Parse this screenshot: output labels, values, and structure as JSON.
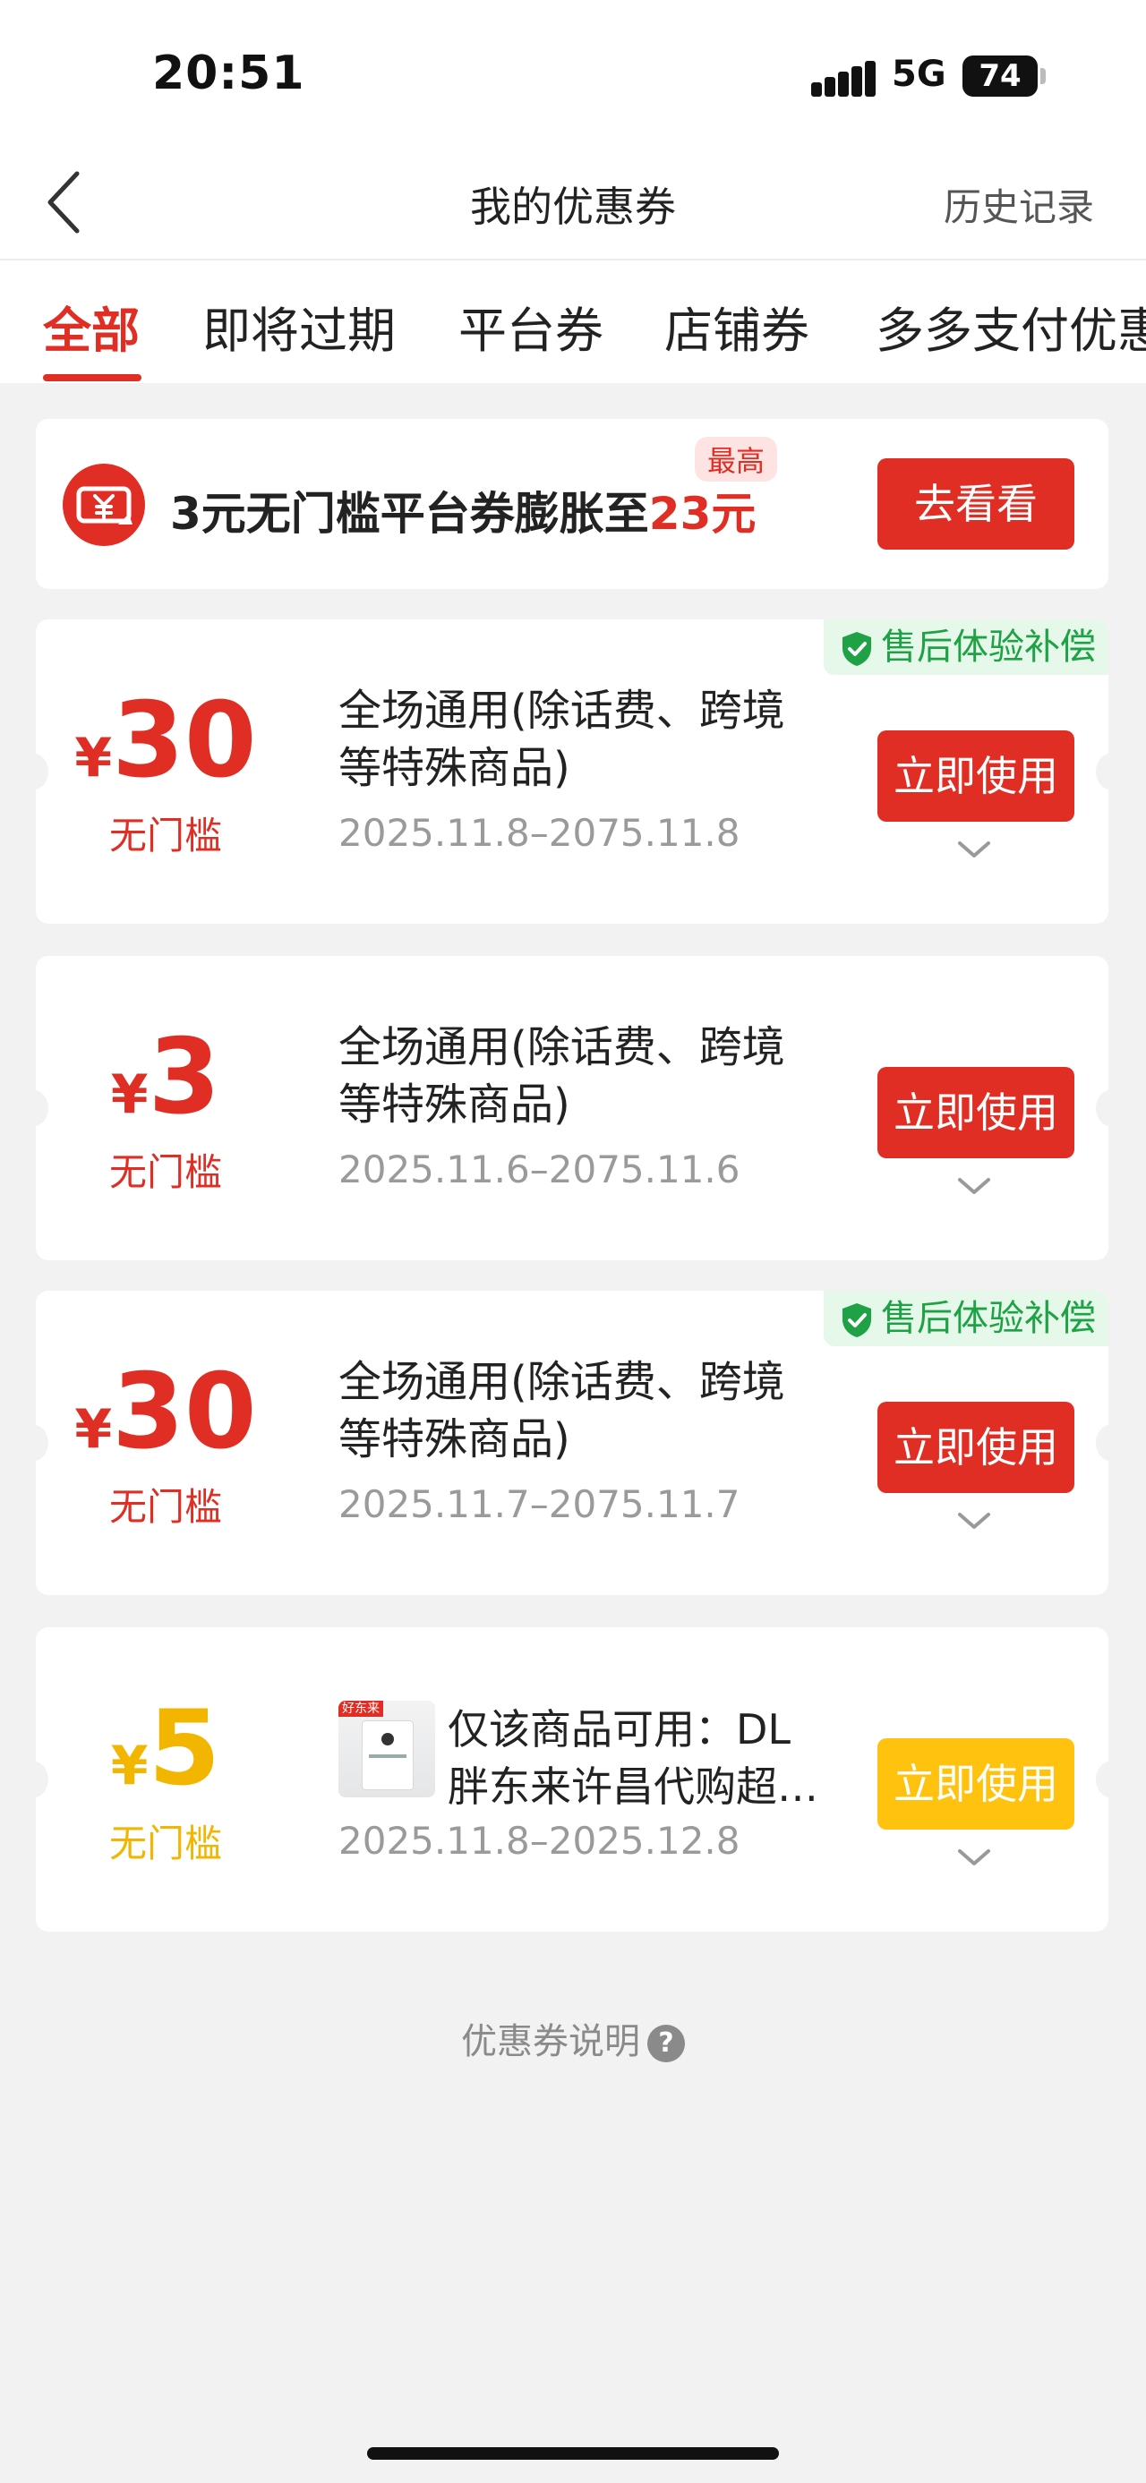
{
  "status_bar": {
    "time": "20:51",
    "network": "5G",
    "battery": "74"
  },
  "nav": {
    "title": "我的优惠券",
    "history": "历史记录"
  },
  "tabs": [
    {
      "label": "全部",
      "active": true
    },
    {
      "label": "即将过期",
      "active": false
    },
    {
      "label": "平台券",
      "active": false
    },
    {
      "label": "店铺券",
      "active": false
    },
    {
      "label": "多多支付优惠",
      "active": false
    }
  ],
  "promo": {
    "text_prefix": "3元无门槛平台券膨胀至",
    "highlight": "23元",
    "tag": "最高",
    "button": "去看看"
  },
  "coupons": [
    {
      "currency": "¥",
      "amount": "30",
      "threshold": "无门槛",
      "description": "全场通用(除话费、跨境等特殊商品)",
      "date": "2025.11.8–2075.11.8",
      "button": "立即使用",
      "badge": "售后体验补偿"
    },
    {
      "currency": "¥",
      "amount": "3",
      "threshold": "无门槛",
      "description": "全场通用(除话费、跨境等特殊商品)",
      "date": "2025.11.6–2075.11.6",
      "button": "立即使用"
    },
    {
      "currency": "¥",
      "amount": "30",
      "threshold": "无门槛",
      "description": "全场通用(除话费、跨境等特殊商品)",
      "date": "2025.11.7–2075.11.7",
      "button": "立即使用",
      "badge": "售后体验补偿"
    },
    {
      "currency": "¥",
      "amount": "5",
      "threshold": "无门槛",
      "description": "仅该商品可用：DL 胖东来许昌代购超…",
      "date": "2025.11.8–2025.12.8",
      "button": "立即使用",
      "thumb_tag": "好东来"
    }
  ],
  "footer": {
    "explain": "优惠券说明",
    "help_glyph": "?"
  },
  "colors": {
    "accent": "#e02e24",
    "yellow": "#ffc20e",
    "green": "#1fa245"
  }
}
